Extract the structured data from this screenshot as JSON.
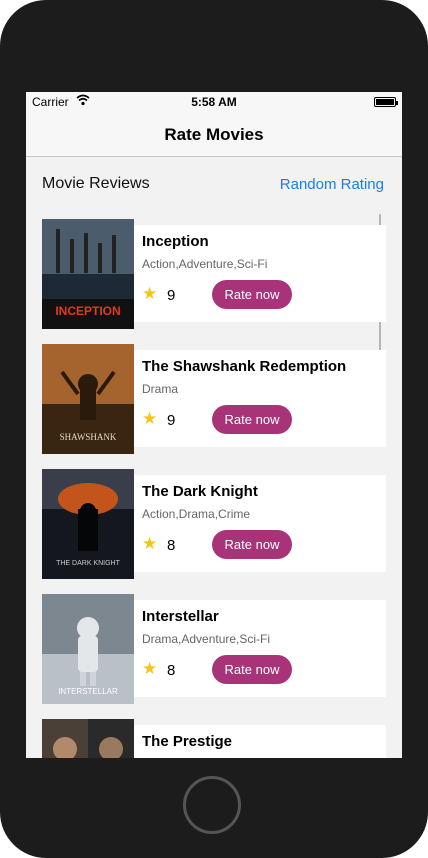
{
  "status_bar": {
    "carrier": "Carrier",
    "time": "5:58 AM"
  },
  "nav": {
    "title": "Rate Movies"
  },
  "header": {
    "section_title": "Movie Reviews",
    "random_rating_label": "Random Rating"
  },
  "movies": [
    {
      "title": "Inception",
      "genres": "Action,Adventure,Sci-Fi",
      "rating": "9",
      "rate_label": "Rate now",
      "poster_caption": "INCEPTION",
      "poster_color": "#2a3b4c"
    },
    {
      "title": "The Shawshank Redemption",
      "genres": "Drama",
      "rating": "9",
      "rate_label": "Rate now",
      "poster_caption": "SHAWSHANK",
      "poster_color": "#6b4a2e"
    },
    {
      "title": "The Dark Knight",
      "genres": "Action,Drama,Crime",
      "rating": "8",
      "rate_label": "Rate now",
      "poster_caption": "THE DARK KNIGHT",
      "poster_color": "#2b2f3a"
    },
    {
      "title": "Interstellar",
      "genres": "Drama,Adventure,Sci-Fi",
      "rating": "8",
      "rate_label": "Rate now",
      "poster_caption": "INTERSTELLAR",
      "poster_color": "#9aa4ad"
    },
    {
      "title": "The Prestige",
      "genres": "",
      "rating": "",
      "rate_label": "",
      "poster_caption": "",
      "poster_color": "#3a3a3a"
    }
  ],
  "colors": {
    "accent": "#a83378",
    "link": "#1a7ee8",
    "star": "#f5c518"
  }
}
